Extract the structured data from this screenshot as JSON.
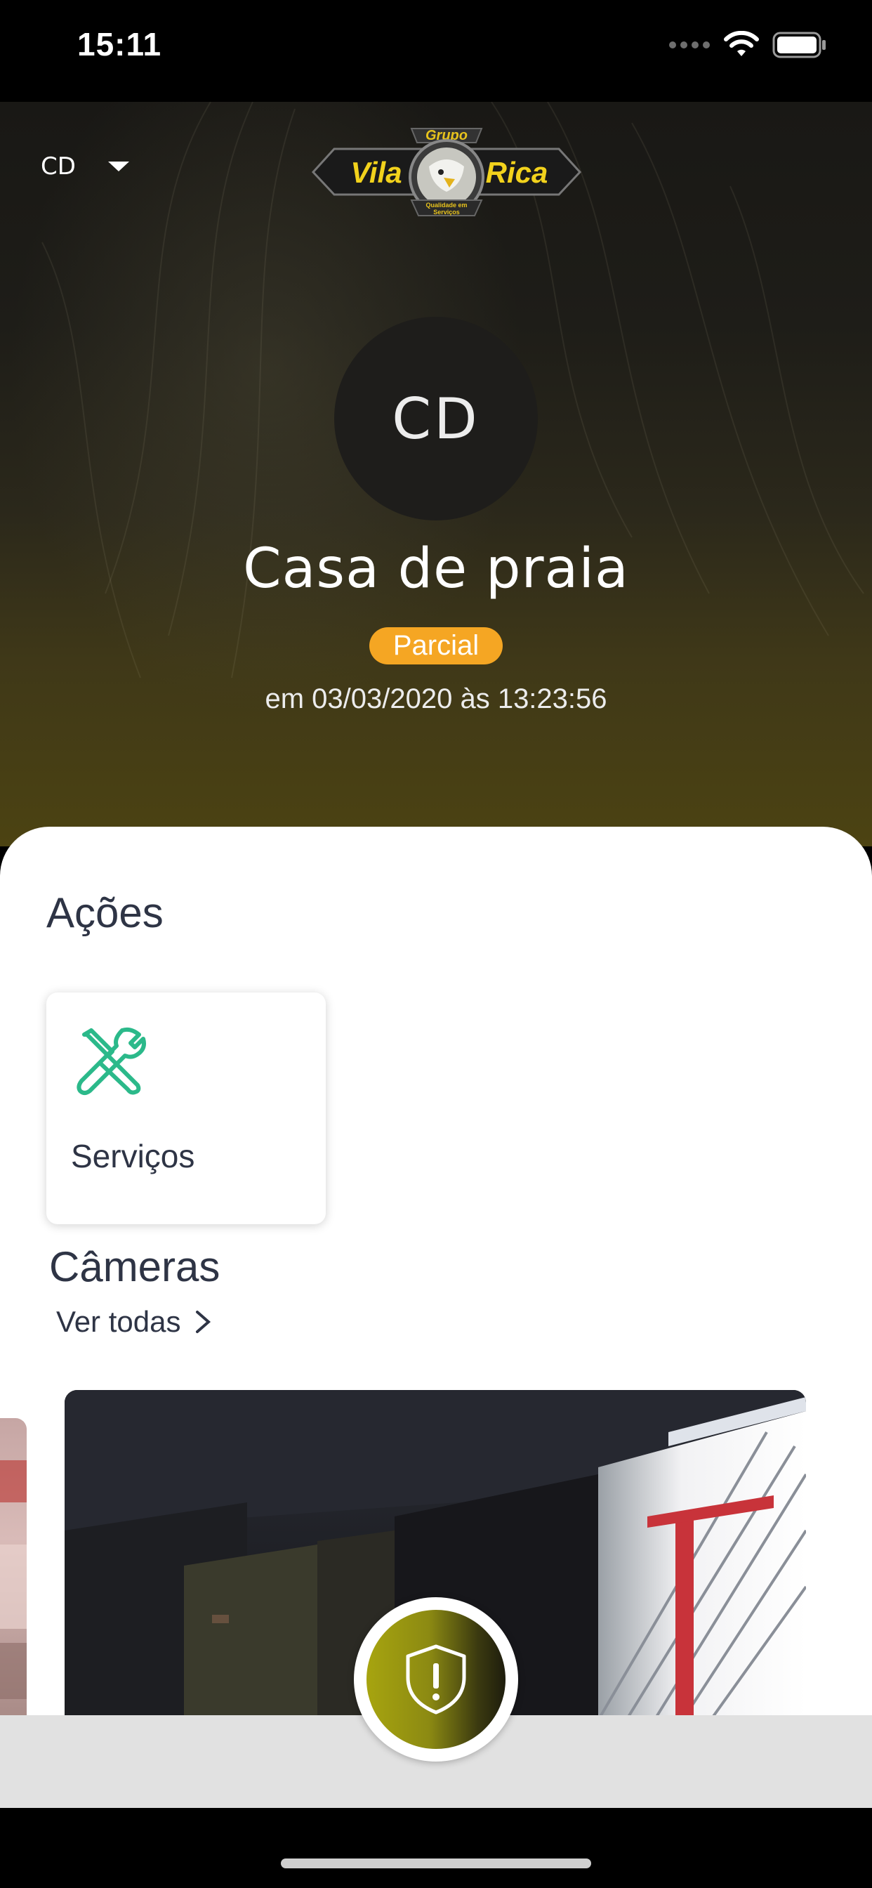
{
  "status_bar": {
    "time": "15:11"
  },
  "header": {
    "account_code": "CD",
    "logo": {
      "top_text": "Grupo",
      "left_text": "Vila",
      "right_text": "Rica",
      "tagline": "Qualidade em Serviços"
    }
  },
  "profile": {
    "avatar_initials": "CD",
    "place_name": "Casa de praia",
    "status_badge": "Parcial",
    "status_color": "#f5a623",
    "timestamp": "em 03/03/2020 às 13:23:56"
  },
  "actions": {
    "title": "Ações",
    "items": [
      {
        "label": "Serviços",
        "icon": "tools-icon",
        "icon_color": "#2bb98a"
      }
    ]
  },
  "cameras": {
    "title": "Câmeras",
    "see_all": "Ver todas"
  },
  "alarm_button": {
    "icon": "shield-alert-icon"
  }
}
